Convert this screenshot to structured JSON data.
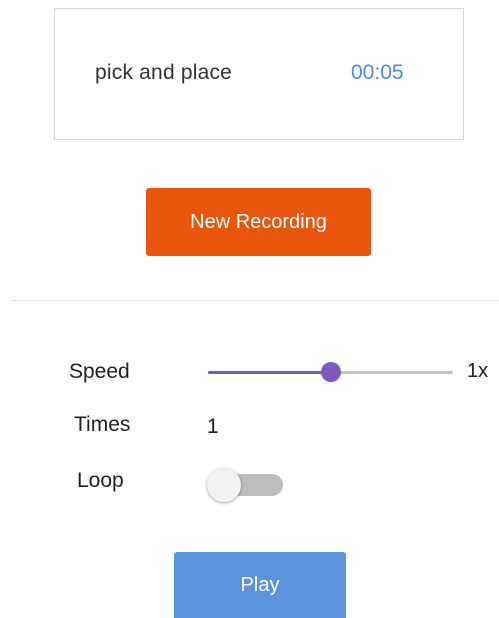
{
  "recording": {
    "name": "pick and place",
    "duration": "00:05"
  },
  "new_recording_button": {
    "label": "New Recording"
  },
  "controls": {
    "speed": {
      "label": "Speed",
      "value_text": "1x",
      "slider_level": 0.5
    },
    "times": {
      "label": "Times",
      "value": "1"
    },
    "loop": {
      "label": "Loop",
      "enabled": false
    }
  },
  "play_button": {
    "label": "Play"
  },
  "colors": {
    "accent_orange": "#e8560e",
    "accent_blue": "#5b93dc",
    "duration_text": "#4a8fd9",
    "slider_purple": "#7e57c2",
    "toggle_off": "#bdbdbd"
  }
}
